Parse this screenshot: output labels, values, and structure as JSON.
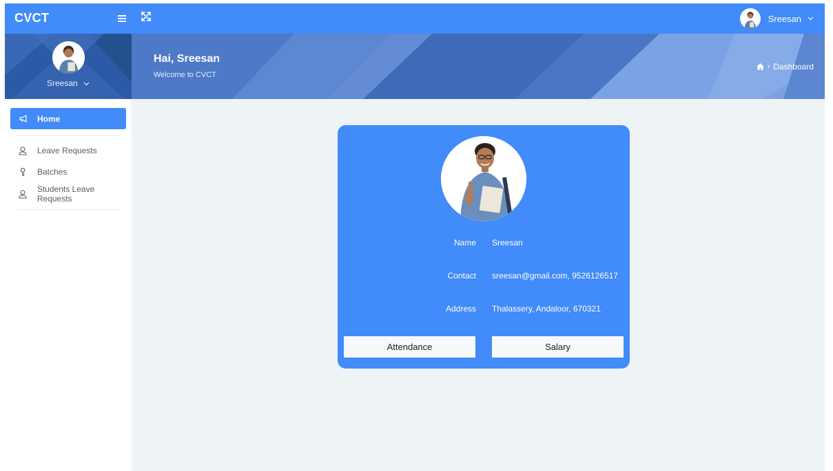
{
  "topbar": {
    "brand": "CVCT",
    "user_name": "Sreesan"
  },
  "sidebar_profile": {
    "name": "Sreesan"
  },
  "banner": {
    "greeting": "Hai, Sreesan",
    "welcome": "Welcome to CVCT",
    "breadcrumb_current": "Dashboard"
  },
  "nav": {
    "home": "Home",
    "items": [
      {
        "label": "Leave Requests",
        "icon": "user-icon"
      },
      {
        "label": "Batches",
        "icon": "key-icon"
      },
      {
        "label": "Students Leave Requests",
        "icon": "user-icon"
      }
    ]
  },
  "profile_card": {
    "fields": [
      {
        "label": "Name",
        "value": "Sreesan"
      },
      {
        "label": "Contact",
        "value": "sreesan@gmail.com, 9526126517"
      },
      {
        "label": "Address",
        "value": "Thalassery, Andaloor, 670321"
      }
    ],
    "attendance_label": "Attendance",
    "salary_label": "Salary"
  },
  "colors": {
    "primary": "#418bfa",
    "banner": "#4b78c9",
    "content_bg": "#eef3f6"
  }
}
